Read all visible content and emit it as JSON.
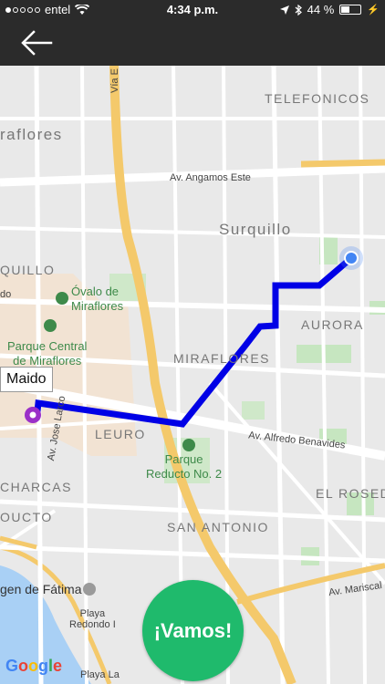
{
  "status_bar": {
    "carrier": "entel",
    "time": "4:34 p.m.",
    "battery_percent": "44 %",
    "battery_level": 0.44,
    "signal_bars_filled": 1,
    "signal_bars_total": 5,
    "icons": [
      "wifi-icon",
      "location-arrow-icon",
      "bluetooth-icon",
      "battery-icon",
      "charging-icon"
    ]
  },
  "nav": {
    "back_icon": "arrow-left-icon"
  },
  "map": {
    "labels": {
      "telefonicos": "TELEFONICOS",
      "miraflores_top": "raflores",
      "av_angamos": "Av. Angamos Este",
      "surquillo": "Surquillo",
      "quillo": "QUILLO",
      "do": "do",
      "ovalo": "Óvalo de\nMiraflores",
      "parque_central": "Parque Central\nde Miraflores",
      "aurora": "AURORA",
      "miraflores": "MIRAFLORES",
      "leuro": "LEURO",
      "av_jose_larco": "Av. Jose Larco",
      "av_alfredo": "Av. Alfredo Benavides",
      "parque_reducto": "Parque\nReducto No. 2",
      "charcas": "CHARCAS",
      "el_rosed": "EL ROSED",
      "oucto": "OUCTO",
      "san_antonio": "SAN ANTONIO",
      "via_ex": "Vía E",
      "fatima": "gen de Fátima",
      "av_mariscal": "Av. Mariscal",
      "playa_redondo": "Playa\nRedondo I",
      "playa_la": "Playa La"
    },
    "callout": "Maido",
    "route_color": "#0000e6",
    "origin_color": "#4285f4",
    "destination_color": "#9b30c8"
  },
  "vamos_button": {
    "label": "¡Vamos!",
    "color": "#1fba6c"
  },
  "google": {
    "g1": "G",
    "o1": "o",
    "o2": "o",
    "g2": "g",
    "l": "l",
    "e": "e"
  }
}
